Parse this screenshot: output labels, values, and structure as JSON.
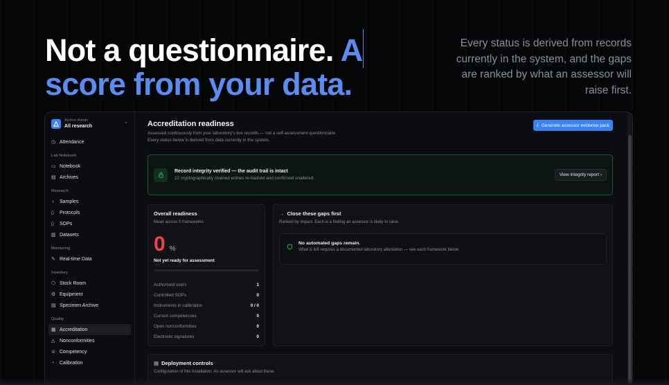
{
  "hero": {
    "title_main": "Not a questionnaire.",
    "title_accent_1": "A",
    "title_accent_2": "score from your data.",
    "subtitle": "Every status is derived from records currently in the system, and the gaps are ranked by what an assessor will raise first."
  },
  "sidebar": {
    "workspace_small": "Archon Admin",
    "workspace_name": "All research",
    "top_item": {
      "label": "Attendance",
      "icon": "clock-icon"
    },
    "sections": [
      {
        "title": "Lab Notebook",
        "items": [
          {
            "label": "Notebook",
            "icon": "book-icon"
          },
          {
            "label": "Archives",
            "icon": "archive-icon"
          }
        ]
      },
      {
        "title": "Research",
        "items": [
          {
            "label": "Samples",
            "icon": "flask-icon"
          },
          {
            "label": "Protocols",
            "icon": "document-icon"
          },
          {
            "label": "SOPs",
            "icon": "document-icon"
          },
          {
            "label": "Datasets",
            "icon": "database-icon"
          }
        ]
      },
      {
        "title": "Monitoring",
        "items": [
          {
            "label": "Real-time Data",
            "icon": "pen-icon"
          }
        ]
      },
      {
        "title": "Inventory",
        "items": [
          {
            "label": "Stock Room",
            "icon": "box-icon"
          },
          {
            "label": "Equipment",
            "icon": "wrench-icon"
          },
          {
            "label": "Specimen Archive",
            "icon": "archive-icon"
          }
        ]
      },
      {
        "title": "Quality",
        "items": [
          {
            "label": "Accreditation",
            "icon": "badge-icon",
            "active": true
          },
          {
            "label": "Nonconformities",
            "icon": "warning-icon"
          },
          {
            "label": "Competency",
            "icon": "graduation-icon"
          },
          {
            "label": "Calibration",
            "icon": "gauge-icon"
          }
        ]
      }
    ]
  },
  "main": {
    "title": "Accreditation readiness",
    "desc_1": "Assessed continuously from your laboratory's live records — not a self-assessment questionnaire.",
    "desc_2": "Every status below is derived from data currently in the system.",
    "generate_button": "Generate assessor evidence pack",
    "integrity": {
      "title": "Record integrity verified — the audit trail is intact",
      "subtitle": "22 cryptographically chained entries re-hashed and confirmed unaltered.",
      "button": "View integrity report"
    },
    "overall": {
      "title": "Overall readiness",
      "subtitle": "Mean across 0 frameworks",
      "score": "0",
      "unit": "%",
      "status": "Not yet ready for assessment",
      "progress": 0,
      "stats": [
        {
          "label": "Authorised users",
          "value": "1"
        },
        {
          "label": "Controlled SOPs",
          "value": "0"
        },
        {
          "label": "Instruments in calibration",
          "value": "0 / 0"
        },
        {
          "label": "Current competencies",
          "value": "0"
        },
        {
          "label": "Open nonconformities",
          "value": "0"
        },
        {
          "label": "Electronic signatures",
          "value": "0"
        }
      ]
    },
    "gaps": {
      "title": "Close these gaps first",
      "subtitle": "Ranked by impact. Each is a finding an assessor is likely to raise.",
      "empty_title": "No automated gaps remain.",
      "empty_subtitle": "What is left requires a documented laboratory attestation — see each framework below."
    },
    "deploy": {
      "title": "Deployment controls",
      "subtitle": "Configuration of this installation. An assessor will ask about these."
    }
  },
  "colors": {
    "accent": "#5b8cf0",
    "primary_button": "#3b82f6",
    "danger": "#ef4444",
    "success": "#22c55e"
  }
}
